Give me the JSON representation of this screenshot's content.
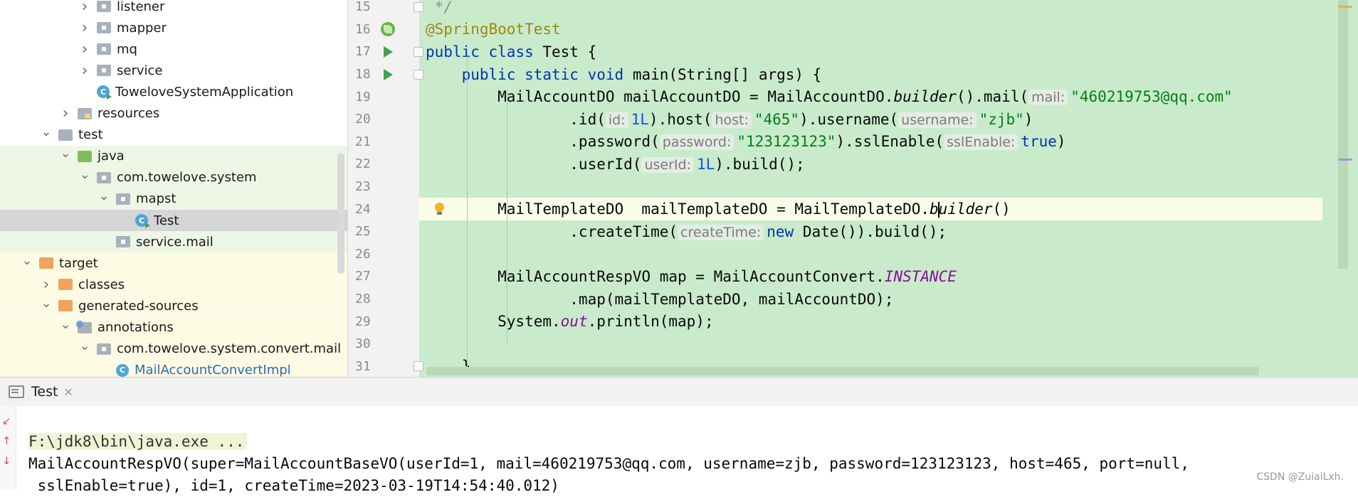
{
  "project_tree": {
    "items": [
      {
        "label": "listener",
        "type": "package",
        "chevron": "right",
        "indent": 1
      },
      {
        "label": "mapper",
        "type": "package",
        "chevron": "right",
        "indent": 1
      },
      {
        "label": "mq",
        "type": "package",
        "chevron": "right",
        "indent": 1
      },
      {
        "label": "service",
        "type": "package",
        "chevron": "right",
        "indent": 1
      },
      {
        "label": "ToweloveSystemApplication",
        "type": "class-run",
        "chevron": "none",
        "indent": 1
      },
      {
        "label": "resources",
        "type": "resources",
        "chevron": "right",
        "indent": 0
      },
      {
        "label": "test",
        "type": "folder",
        "chevron": "down",
        "indent": -1
      },
      {
        "label": "java",
        "type": "test-root",
        "chevron": "down",
        "indent": 0
      },
      {
        "label": "com.towelove.system",
        "type": "package",
        "chevron": "down",
        "indent": 1
      },
      {
        "label": "mapst",
        "type": "package",
        "chevron": "down",
        "indent": 2
      },
      {
        "label": "Test",
        "type": "class",
        "chevron": "none",
        "indent": 3
      },
      {
        "label": "service.mail",
        "type": "package",
        "chevron": "none",
        "indent": 2
      },
      {
        "label": "target",
        "type": "excluded",
        "chevron": "down",
        "indent": -2
      },
      {
        "label": "classes",
        "type": "excluded",
        "chevron": "right",
        "indent": -1
      },
      {
        "label": "generated-sources",
        "type": "excluded",
        "chevron": "down",
        "indent": -1
      },
      {
        "label": "annotations",
        "type": "annotations",
        "chevron": "down",
        "indent": 0
      },
      {
        "label": "com.towelove.system.convert.mail",
        "type": "package",
        "chevron": "down",
        "indent": 1
      },
      {
        "label": "MailAccountConvertImpl",
        "type": "class",
        "chevron": "none",
        "indent": 2
      }
    ]
  },
  "editor": {
    "lines": [
      {
        "num": "15",
        "html_key": "l15"
      },
      {
        "num": "16",
        "html_key": "l16"
      },
      {
        "num": "17",
        "html_key": "l17"
      },
      {
        "num": "18",
        "html_key": "l18"
      },
      {
        "num": "19",
        "html_key": "l19"
      },
      {
        "num": "20",
        "html_key": "l20"
      },
      {
        "num": "21",
        "html_key": "l21"
      },
      {
        "num": "22",
        "html_key": "l22"
      },
      {
        "num": "23",
        "html_key": "l23"
      },
      {
        "num": "24",
        "html_key": "l24"
      },
      {
        "num": "25",
        "html_key": "l25"
      },
      {
        "num": "26",
        "html_key": "l26"
      },
      {
        "num": "27",
        "html_key": "l27"
      },
      {
        "num": "28",
        "html_key": "l28"
      },
      {
        "num": "29",
        "html_key": "l29"
      },
      {
        "num": "30",
        "html_key": "l30"
      },
      {
        "num": "31",
        "html_key": "l31"
      }
    ],
    "tokens": {
      "l15": [
        {
          "t": " */",
          "c": "cmt"
        }
      ],
      "l16": [
        {
          "t": "@SpringBootTest",
          "c": "ann"
        }
      ],
      "l17": [
        {
          "t": "public ",
          "c": "kw"
        },
        {
          "t": "class ",
          "c": "kw"
        },
        {
          "t": "Test {",
          "c": ""
        }
      ],
      "l18": [
        {
          "t": "    public ",
          "c": "kw"
        },
        {
          "t": "static ",
          "c": "kw"
        },
        {
          "t": "void ",
          "c": "kw"
        },
        {
          "t": "main(String[] args) {",
          "c": ""
        }
      ],
      "l19": [
        {
          "t": "        MailAccountDO mailAccountDO = MailAccountDO.",
          "c": ""
        },
        {
          "t": "builder",
          "c": "it"
        },
        {
          "t": "().mail(",
          "c": ""
        },
        {
          "t": "mail:",
          "c": "hint"
        },
        {
          "t": "\"460219753@qq.com\"",
          "c": "str"
        }
      ],
      "l20": [
        {
          "t": "                .id(",
          "c": ""
        },
        {
          "t": "id:",
          "c": "hint"
        },
        {
          "t": "1L",
          "c": "num"
        },
        {
          "t": ").host(",
          "c": ""
        },
        {
          "t": "host:",
          "c": "hint"
        },
        {
          "t": "\"465\"",
          "c": "str"
        },
        {
          "t": ").username(",
          "c": ""
        },
        {
          "t": "username:",
          "c": "hint"
        },
        {
          "t": "\"zjb\"",
          "c": "str"
        },
        {
          "t": ")",
          "c": ""
        }
      ],
      "l21": [
        {
          "t": "                .password(",
          "c": ""
        },
        {
          "t": "password:",
          "c": "hint"
        },
        {
          "t": "\"123123123\"",
          "c": "str"
        },
        {
          "t": ").sslEnable(",
          "c": ""
        },
        {
          "t": "sslEnable:",
          "c": "hint"
        },
        {
          "t": "true",
          "c": "kw"
        },
        {
          "t": ")",
          "c": ""
        }
      ],
      "l22": [
        {
          "t": "                .userId(",
          "c": ""
        },
        {
          "t": "userId:",
          "c": "hint"
        },
        {
          "t": "1L",
          "c": "num"
        },
        {
          "t": ").build();",
          "c": ""
        }
      ],
      "l23": [],
      "l24": [
        {
          "t": "        MailTemplateDO  mailTemplateDO = MailTemplateDO.",
          "c": ""
        },
        {
          "t": "b",
          "c": "it"
        },
        {
          "t": "|caret|",
          "c": "caret"
        },
        {
          "t": "uilder",
          "c": "it"
        },
        {
          "t": "()",
          "c": ""
        }
      ],
      "l25": [
        {
          "t": "                .createTime(",
          "c": ""
        },
        {
          "t": "createTime:",
          "c": "hint"
        },
        {
          "t": "new ",
          "c": "kw"
        },
        {
          "t": "Date()).build();",
          "c": ""
        }
      ],
      "l26": [],
      "l27": [
        {
          "t": "        MailAccountRespVO map = MailAccountConvert.",
          "c": ""
        },
        {
          "t": "INSTANCE",
          "c": "static-field"
        }
      ],
      "l28": [
        {
          "t": "                .map(mailTemplateDO, mailAccountDO);",
          "c": ""
        }
      ],
      "l29": [
        {
          "t": "        System.",
          "c": ""
        },
        {
          "t": "out",
          "c": "static-field"
        },
        {
          "t": ".println(map);",
          "c": ""
        }
      ],
      "l30": [],
      "l31": [
        {
          "t": "    }",
          "c": ""
        }
      ]
    },
    "gutter_icons": {
      "16": "spring-bean-icon",
      "17": "run-icon",
      "18": "run-icon",
      "24": "intention-bulb-icon"
    },
    "current_line": "24"
  },
  "run_panel": {
    "tab_label": "Test",
    "console_lines": [
      "F:\\jdk8\\bin\\java.exe ...",
      "MailAccountRespVO(super=MailAccountBaseVO(userId=1, mail=460219753@qq.com, username=zjb, password=123123123, host=465, port=null,",
      " sslEnable=true), id=1, createTime=2023-03-19T14:54:40.012)"
    ]
  },
  "watermark": "CSDN @ZuiaiLxh."
}
